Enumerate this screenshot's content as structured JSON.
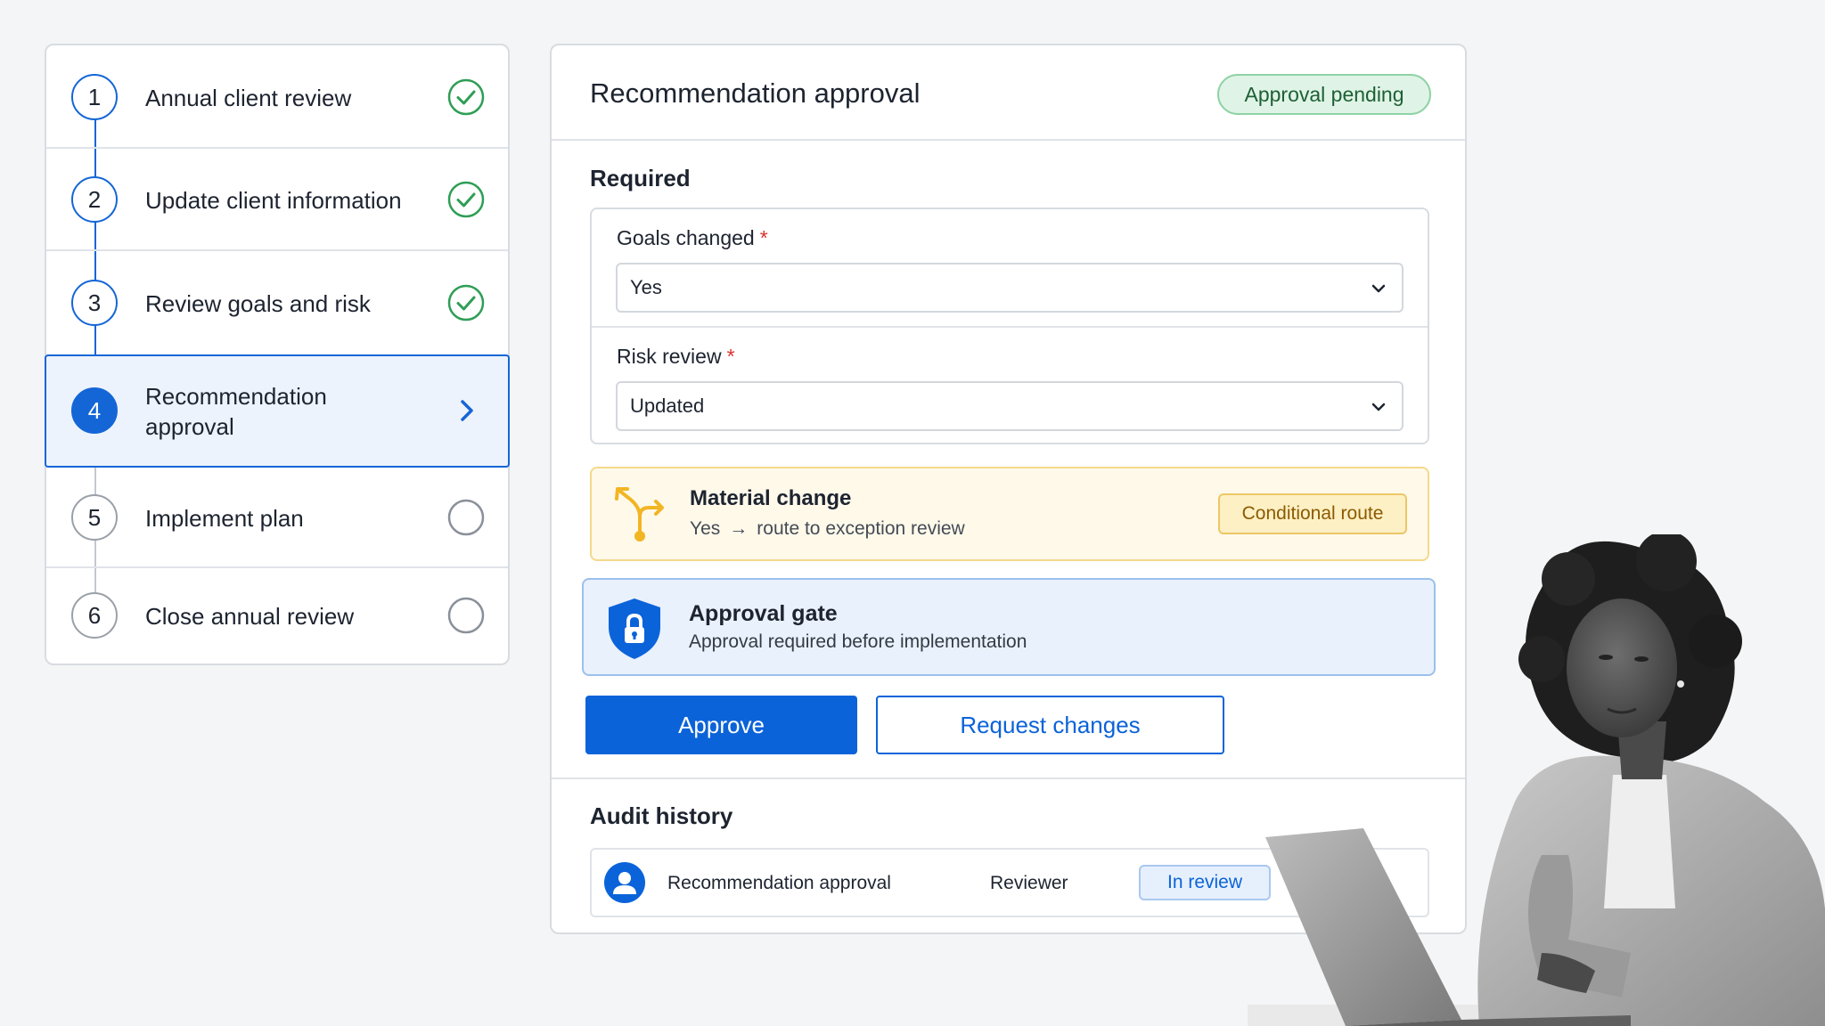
{
  "stepper": {
    "steps": [
      {
        "number": "1",
        "label": "Annual client review",
        "status": "complete",
        "status_icon": "check-circle-icon"
      },
      {
        "number": "2",
        "label": "Update client information",
        "status": "complete",
        "status_icon": "check-circle-icon"
      },
      {
        "number": "3",
        "label": "Review goals and risk",
        "status": "complete",
        "status_icon": "check-circle-icon"
      },
      {
        "number": "4",
        "label_line1": "Recommendation",
        "label_line2": "approval",
        "status": "active",
        "status_icon": "chevron-right-icon"
      },
      {
        "number": "5",
        "label": "Implement plan",
        "status": "pending",
        "status_icon": "empty-circle-icon"
      },
      {
        "number": "6",
        "label": "Close annual review",
        "status": "pending",
        "status_icon": "empty-circle-icon"
      }
    ]
  },
  "panel": {
    "title": "Recommendation approval",
    "status_badge": "Approval pending",
    "required": {
      "heading": "Required",
      "fields": [
        {
          "label": "Goals changed",
          "required_marker": "*",
          "value": "Yes"
        },
        {
          "label": "Risk review",
          "required_marker": "*",
          "value": "Updated"
        }
      ]
    },
    "material_change": {
      "title": "Material change",
      "condition": "Yes",
      "arrow": "→",
      "route": "route to exception review",
      "badge": "Conditional route",
      "icon": "branch-arrows-icon"
    },
    "approval_gate": {
      "title": "Approval gate",
      "subtitle": "Approval required before implementation",
      "icon": "shield-lock-icon"
    },
    "actions": {
      "approve_label": "Approve",
      "request_changes_label": "Request changes"
    },
    "audit": {
      "heading": "Audit history",
      "entries": [
        {
          "item": "Recommendation approval",
          "role": "Reviewer",
          "status": "In review",
          "icon": "user-avatar-icon"
        }
      ]
    }
  },
  "colors": {
    "primary": "#0b63d9",
    "success": "#2e9e55",
    "pending_badge_bg": "#dff4e6",
    "warning_bg": "#fff9ea",
    "warning_accent": "#f2b523",
    "gate_bg": "#e9f1fc",
    "required_marker": "#d9322b"
  }
}
